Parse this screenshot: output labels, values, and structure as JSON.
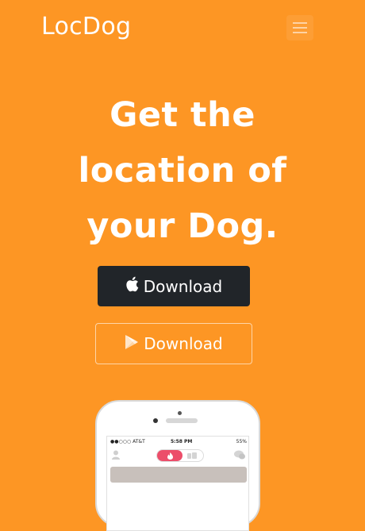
{
  "navbar": {
    "brand": "LocDog",
    "menu_icon": "hamburger-menu-icon"
  },
  "hero": {
    "headline_lines": [
      "Get the",
      "location of",
      "your Dog."
    ]
  },
  "downloads": {
    "apple_label": "Download",
    "apple_icon": "apple-icon",
    "play_label": "Download",
    "play_icon": "google-play-icon"
  },
  "phone": {
    "carrier": "●●○○○ AT&T",
    "time": "5:58 PM",
    "battery": "55%",
    "icons": [
      "profile-icon",
      "flame-icon",
      "cards-icon",
      "chat-icon"
    ]
  },
  "colors": {
    "background": "#fd9624",
    "apple_button": "#212529",
    "accent_pink": "#ec4e6a"
  }
}
